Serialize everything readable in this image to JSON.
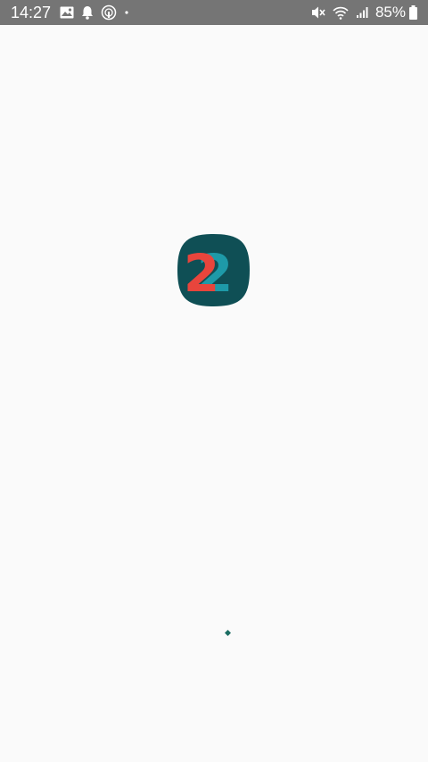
{
  "status_bar": {
    "time": "14:27",
    "battery_percent": "85%",
    "icons_left": [
      "image-icon",
      "notification-bell-icon",
      "hotspot-icon",
      "more-dot-icon"
    ],
    "icons_right": [
      "mute-icon",
      "wifi-icon",
      "signal-icon",
      "battery-icon"
    ]
  },
  "splash": {
    "logo_digits": [
      "2",
      "2"
    ],
    "logo_colors": {
      "background": "#0f4f55",
      "first_digit": "#e8453c",
      "second_digit": "#1e9aa8"
    },
    "loading_indicator_color": "#1b6d62"
  }
}
